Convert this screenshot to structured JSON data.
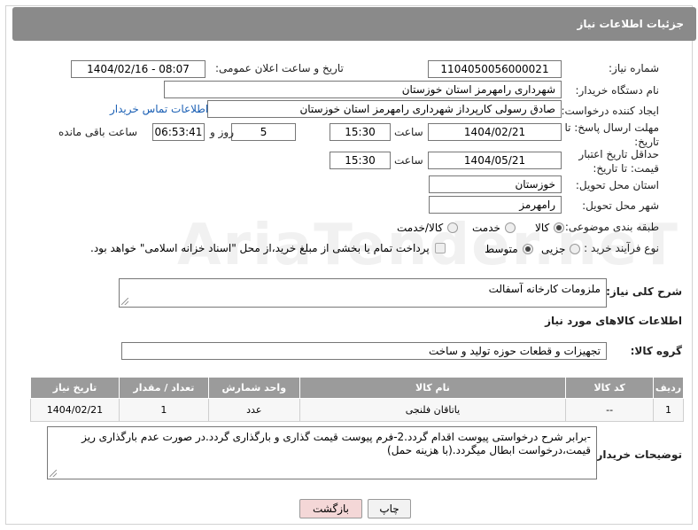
{
  "header": {
    "title": "جزئیات اطلاعات نیاز"
  },
  "fields": {
    "need_number_label": "شماره نیاز:",
    "need_number": "1104050056000021",
    "announce_label": "تاریخ و ساعت اعلان عمومی:",
    "announce_value": "1404/02/16 - 08:07",
    "buyer_org_label": "نام دستگاه خریدار:",
    "buyer_org": "شهرداری رامهرمز استان خوزستان",
    "creator_label": "ایجاد کننده درخواست:",
    "creator": "صادق رسولی کارپرداز شهرداری رامهرمز استان خوزستان",
    "contact_link": "اطلاعات تماس خریدار",
    "deadline_label": "مهلت ارسال پاسخ: تا تاریخ:",
    "deadline_date": "1404/02/21",
    "hour_label": "ساعت",
    "deadline_time": "15:30",
    "days_value": "5",
    "days_label": "روز و",
    "remaining_time": "06:53:41",
    "remaining_label": "ساعت باقی مانده",
    "validity_label": "حداقل تاریخ اعتبار قیمت: تا تاریخ:",
    "validity_date": "1404/05/21",
    "validity_time": "15:30",
    "province_label": "استان محل تحویل:",
    "province": "خوزستان",
    "city_label": "شهر محل تحویل:",
    "city": "رامهرمز",
    "category_label": "طبقه بندی موضوعی:",
    "category_options": [
      "کالا",
      "خدمت",
      "کالا/خدمت"
    ],
    "process_label": "نوع فرآیند خرید :",
    "process_options": [
      "جزیی",
      "متوسط"
    ],
    "payment_note": "پرداخت تمام یا بخشی از مبلغ خرید،از محل \"اسناد خزانه اسلامی\" خواهد بود."
  },
  "description": {
    "label": "شرح کلی نیاز:",
    "value": "ملزومات کارخانه آسفالت"
  },
  "goods_section_title": "اطلاعات کالاهای مورد نیاز",
  "goods_group": {
    "label": "گروه کالا:",
    "value": "تجهیزات و قطعات حوزه تولید و ساخت"
  },
  "table": {
    "headers": [
      "ردیف",
      "کد کالا",
      "نام کالا",
      "واحد شمارش",
      "تعداد / مقدار",
      "تاریخ نیاز"
    ],
    "rows": [
      [
        "1",
        "--",
        "یاتاقان فلنجی",
        "عدد",
        "1",
        "1404/02/21"
      ]
    ]
  },
  "buyer_notes": {
    "label": "توضیحات خریدار:",
    "value": "-برابر شرح درخواستی پیوست اقدام گردد.2-فرم پیوست قیمت گذاری و بارگذاری گردد.در صورت عدم بارگذاری ریز قیمت،درخواست ابطال میگردد.(با هزینه حمل)"
  },
  "buttons": {
    "print": "چاپ",
    "back": "بازگشت"
  },
  "watermark": "AriaTender.neT",
  "colors": {
    "titlebar": "#8a8a8a",
    "table_header": "#9b9b9b",
    "link": "#1a5fb4",
    "back_button": "#f4d7d7"
  }
}
